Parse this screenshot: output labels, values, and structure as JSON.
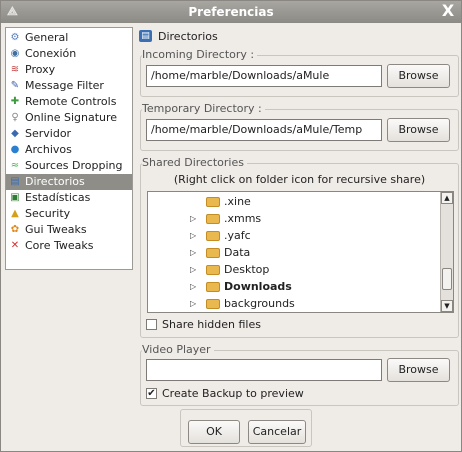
{
  "window": {
    "title": "Preferencias",
    "close_glyph": "X"
  },
  "sidebar": {
    "items": [
      {
        "label": "General",
        "icon": "general-icon",
        "color": "#5a7fc0",
        "glyph": "⚙"
      },
      {
        "label": "Conexión",
        "icon": "connection-icon",
        "color": "#3f6fa0",
        "glyph": "◉"
      },
      {
        "label": "Proxy",
        "icon": "proxy-icon",
        "color": "#c04040",
        "glyph": "≋"
      },
      {
        "label": "Message Filter",
        "icon": "message-filter-icon",
        "color": "#3b5ea8",
        "glyph": "✎"
      },
      {
        "label": "Remote Controls",
        "icon": "remote-controls-icon",
        "color": "#3e9a3e",
        "glyph": "✚"
      },
      {
        "label": "Online Signature",
        "icon": "online-signature-icon",
        "color": "#888",
        "glyph": "♀"
      },
      {
        "label": "Servidor",
        "icon": "server-icon",
        "color": "#3a6ab0",
        "glyph": "◆"
      },
      {
        "label": "Archivos",
        "icon": "files-icon",
        "color": "#2a7fd0",
        "glyph": "●"
      },
      {
        "label": "Sources Dropping",
        "icon": "sources-dropping-icon",
        "color": "#4caf50",
        "glyph": "≈"
      },
      {
        "label": "Directorios",
        "icon": "directories-icon",
        "color": "#3c6fb2",
        "glyph": "▤"
      },
      {
        "label": "Estadísticas",
        "icon": "statistics-icon",
        "color": "#2e7d32",
        "glyph": "▣"
      },
      {
        "label": "Security",
        "icon": "security-icon",
        "color": "#d4a017",
        "glyph": "▲"
      },
      {
        "label": "Gui Tweaks",
        "icon": "gui-tweaks-icon",
        "color": "#e08a1e",
        "glyph": "✿"
      },
      {
        "label": "Core Tweaks",
        "icon": "core-tweaks-icon",
        "color": "#d32f2f",
        "glyph": "✕"
      }
    ],
    "selected": "Directorios"
  },
  "panel": {
    "title": "Directorios"
  },
  "incoming": {
    "label": "Incoming Directory :",
    "value": "/home/marble/Downloads/aMule",
    "browse": "Browse"
  },
  "temporary": {
    "label": "Temporary Directory :",
    "value": "/home/marble/Downloads/aMule/Temp",
    "browse": "Browse"
  },
  "shared": {
    "label": "Shared Directories",
    "hint": "(Right click on folder icon for recursive share)",
    "tree": [
      {
        "name": ".xine",
        "has_arrow": false,
        "bold": false
      },
      {
        "name": ".xmms",
        "has_arrow": true,
        "bold": false
      },
      {
        "name": ".yafc",
        "has_arrow": true,
        "bold": false
      },
      {
        "name": "Data",
        "has_arrow": true,
        "bold": false
      },
      {
        "name": "Desktop",
        "has_arrow": true,
        "bold": false
      },
      {
        "name": "Downloads",
        "has_arrow": true,
        "bold": true
      },
      {
        "name": "backgrounds",
        "has_arrow": true,
        "bold": false
      }
    ],
    "share_hidden": {
      "label": "Share hidden files",
      "checked": false
    }
  },
  "video": {
    "label": "Video Player",
    "value": "",
    "browse": "Browse",
    "backup": {
      "label": "Create Backup to preview",
      "checked": true
    }
  },
  "buttons": {
    "ok": "OK",
    "cancel": "Cancelar"
  }
}
